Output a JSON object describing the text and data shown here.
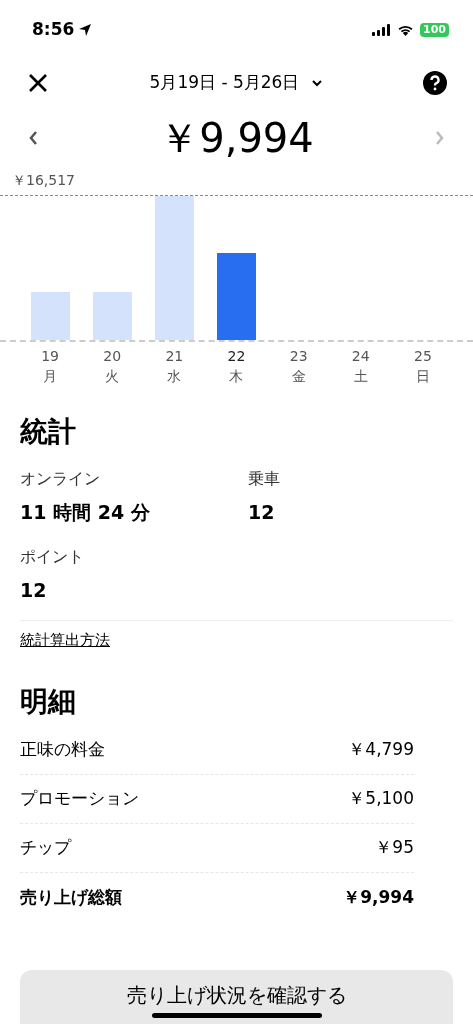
{
  "status_bar": {
    "time": "8:56",
    "battery": "100"
  },
  "header": {
    "date_range": "5月19日 - 5月26日"
  },
  "total": "￥9,994",
  "chart": {
    "max_label": "￥16,517",
    "days": [
      {
        "day": "19",
        "weekday": "月",
        "selected": false
      },
      {
        "day": "20",
        "weekday": "火",
        "selected": false
      },
      {
        "day": "21",
        "weekday": "水",
        "selected": false
      },
      {
        "day": "22",
        "weekday": "木",
        "selected": true
      },
      {
        "day": "23",
        "weekday": "金",
        "selected": false
      },
      {
        "day": "24",
        "weekday": "土",
        "selected": false
      },
      {
        "day": "25",
        "weekday": "日",
        "selected": false
      }
    ]
  },
  "stats": {
    "title": "統計",
    "items": [
      {
        "label": "オンライン",
        "value": "11 時間 24 分"
      },
      {
        "label": "乗車",
        "value": "12"
      },
      {
        "label": "ポイント",
        "value": "12"
      }
    ],
    "link": "統計算出方法"
  },
  "breakdown": {
    "title": "明細",
    "rows": [
      {
        "label": "正味の料金",
        "amount": "￥4,799",
        "total": false
      },
      {
        "label": "プロモーション",
        "amount": "￥5,100",
        "total": false
      },
      {
        "label": "チップ",
        "amount": "￥95",
        "total": false
      },
      {
        "label": "売り上げ総額",
        "amount": "￥9,994",
        "total": true
      }
    ]
  },
  "button": "売り上げ状況を確認する"
}
